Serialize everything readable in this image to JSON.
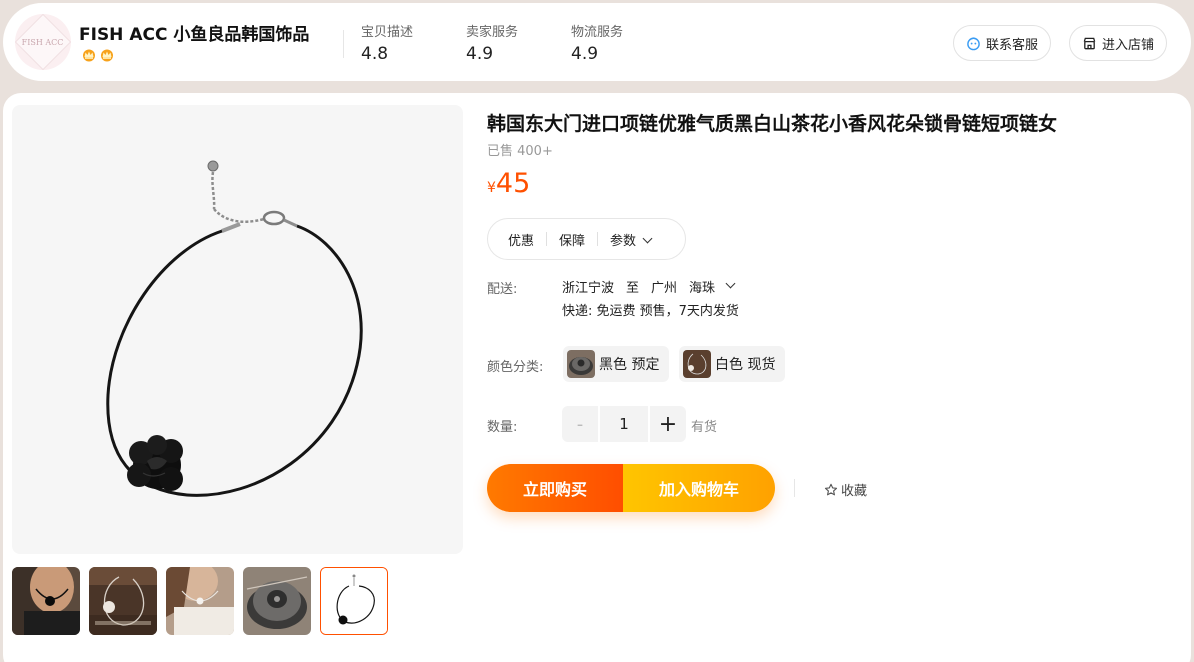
{
  "shop": {
    "logo_text": "FISH ACC",
    "name": "FISH ACC 小鱼良品韩国饰品",
    "ratings": [
      {
        "label": "宝贝描述",
        "value": "4.8"
      },
      {
        "label": "卖家服务",
        "value": "4.9"
      },
      {
        "label": "物流服务",
        "value": "4.9"
      }
    ],
    "contact_label": "联系客服",
    "enter_store_label": "进入店铺"
  },
  "product": {
    "title": "韩国东大门进口项链优雅气质黑白山茶花小香风花朵锁骨链短项链女",
    "sold": "已售 400+",
    "currency": "¥",
    "price": "45",
    "accent_color": "#ff5000"
  },
  "tabs": [
    "优惠",
    "保障",
    "参数"
  ],
  "shipping": {
    "label": "配送:",
    "from": "浙江宁波",
    "to_word": "至",
    "city": "广州",
    "district": "海珠",
    "detail": "快递: 免运费  预售，7天内发货"
  },
  "sku": {
    "label": "颜色分类:",
    "options": [
      "黑色 预定",
      "白色 现货"
    ]
  },
  "quantity": {
    "label": "数量:",
    "minus": "-",
    "value": "1",
    "plus": "+",
    "stock": "有货"
  },
  "actions": {
    "buy_now": "立即购买",
    "add_to_cart": "加入购物车",
    "favorite": "收藏"
  },
  "icons": {
    "contact": "headset-icon",
    "store": "store-icon",
    "favorite": "star-icon",
    "dropdown": "chevron-down-icon"
  }
}
